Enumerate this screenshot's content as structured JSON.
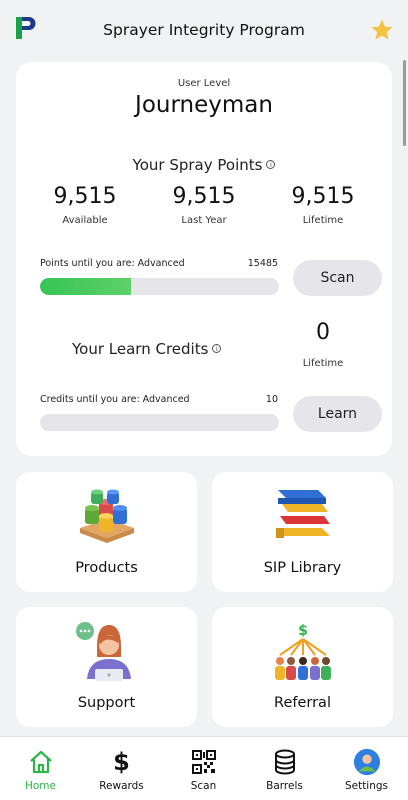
{
  "header": {
    "title": "Sprayer Integrity Program",
    "logo_icon": "app-logo-icon",
    "favorite_icon": "star-icon"
  },
  "user_level": {
    "label": "User Level",
    "value": "Journeyman"
  },
  "spray_points": {
    "title": "Your Spray Points",
    "stats": [
      {
        "value": "9,515",
        "label": "Available"
      },
      {
        "value": "9,515",
        "label": "Last Year"
      },
      {
        "value": "9,515",
        "label": "Lifetime"
      }
    ],
    "progress_label": "Points until you are: Advanced",
    "progress_target": "15485",
    "progress_fraction": 0.38,
    "button_label": "Scan"
  },
  "learn_credits": {
    "title": "Your Learn Credits",
    "value": "0",
    "value_label": "Lifetime",
    "progress_label": "Credits until you are: Advanced",
    "progress_target": "10",
    "progress_fraction": 0,
    "button_label": "Learn"
  },
  "tiles": [
    {
      "label": "Products",
      "icon": "barrels-pallet-illustration"
    },
    {
      "label": "SIP Library",
      "icon": "books-illustration"
    },
    {
      "label": "Support",
      "icon": "support-agent-illustration"
    },
    {
      "label": "Referral",
      "icon": "referral-group-illustration"
    }
  ],
  "nav": [
    {
      "label": "Home",
      "icon": "home-icon",
      "active": true
    },
    {
      "label": "Rewards",
      "icon": "dollar-icon",
      "active": false
    },
    {
      "label": "Scan",
      "icon": "qr-code-icon",
      "active": false
    },
    {
      "label": "Barrels",
      "icon": "barrel-icon",
      "active": false
    },
    {
      "label": "Settings",
      "icon": "avatar-icon",
      "active": false
    }
  ],
  "colors": {
    "accent_green": "#36c456",
    "background": "#f1f2f4",
    "star": "#f5c242"
  }
}
